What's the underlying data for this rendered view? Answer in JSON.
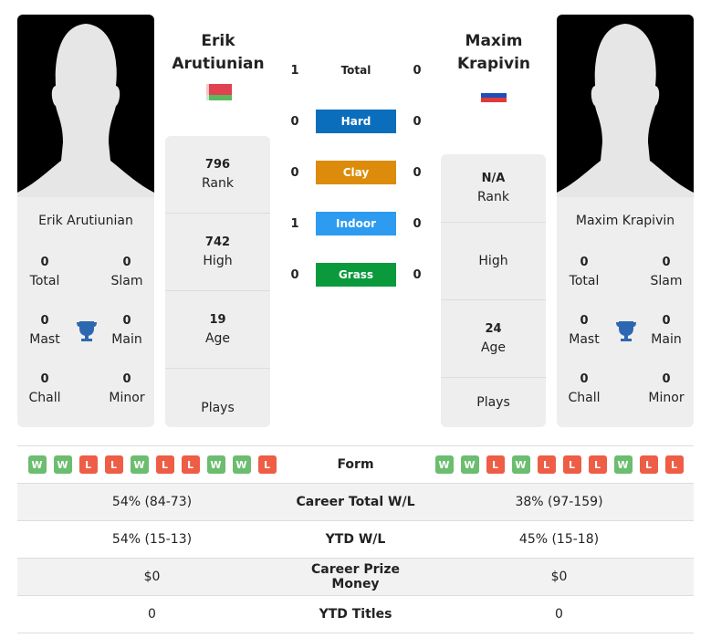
{
  "player1": {
    "name_line1": "Erik",
    "name_line2": "Arutiunian",
    "full_name": "Erik Arutiunian",
    "flag": "belarus-flag",
    "titles": {
      "total": "0",
      "slam": "0",
      "mast": "0",
      "main": "0",
      "chall": "0",
      "minor": "0"
    },
    "rank": "796",
    "high": "742",
    "age": "19",
    "plays": ""
  },
  "player2": {
    "name_line1": "Maxim",
    "name_line2": "Krapivin",
    "full_name": "Maxim Krapivin",
    "flag": "russia-flag",
    "titles": {
      "total": "0",
      "slam": "0",
      "mast": "0",
      "main": "0",
      "chall": "0",
      "minor": "0"
    },
    "rank": "N/A",
    "high": "",
    "age": "24",
    "plays": ""
  },
  "labels": {
    "total": "Total",
    "slam": "Slam",
    "mast": "Mast",
    "main": "Main",
    "chall": "Chall",
    "minor": "Minor",
    "rank": "Rank",
    "high": "High",
    "age": "Age",
    "plays": "Plays"
  },
  "h2h": [
    {
      "label": "Total",
      "p1": "1",
      "p2": "0",
      "color": ""
    },
    {
      "label": "Hard",
      "p1": "0",
      "p2": "0",
      "color": "#0a6ebd"
    },
    {
      "label": "Clay",
      "p1": "0",
      "p2": "0",
      "color": "#dd8b0a"
    },
    {
      "label": "Indoor",
      "p1": "1",
      "p2": "0",
      "color": "#2d9bf0"
    },
    {
      "label": "Grass",
      "p1": "0",
      "p2": "0",
      "color": "#0a9a3c"
    }
  ],
  "stats": {
    "form_label": "Form",
    "p1_form": [
      "W",
      "W",
      "L",
      "L",
      "W",
      "L",
      "L",
      "W",
      "W",
      "L"
    ],
    "p2_form": [
      "W",
      "W",
      "L",
      "W",
      "L",
      "L",
      "L",
      "W",
      "L",
      "L"
    ],
    "rows": [
      {
        "label": "Career Total W/L",
        "p1": "54% (84-73)",
        "p2": "38% (97-159)"
      },
      {
        "label": "YTD W/L",
        "p1": "54% (15-13)",
        "p2": "45% (15-18)"
      },
      {
        "label": "Career Prize Money",
        "p1": "$0",
        "p2": "$0"
      },
      {
        "label": "YTD Titles",
        "p1": "0",
        "p2": "0"
      }
    ]
  }
}
